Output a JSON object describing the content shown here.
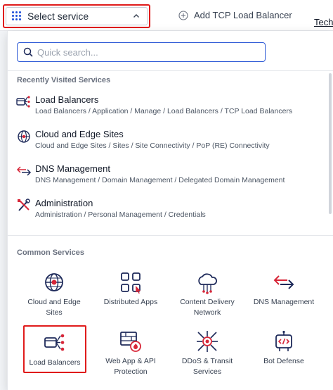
{
  "header": {
    "select_label": "Select service",
    "add_tcp_label": "Add TCP Load Balancer",
    "tech_link": "Tech"
  },
  "search": {
    "placeholder": "Quick search...",
    "value": ""
  },
  "recent": {
    "title": "Recently Visited Services",
    "items": [
      {
        "name": "Load Balancers",
        "path": "Load Balancers / Application / Manage / Load Balancers / TCP Load Balancers",
        "icon": "load-balancer-icon"
      },
      {
        "name": "Cloud and Edge Sites",
        "path": "Cloud and Edge Sites / Sites / Site Connectivity / PoP (RE) Connectivity",
        "icon": "globe-icon"
      },
      {
        "name": "DNS Management",
        "path": "DNS Management / Domain Management / Delegated Domain Management",
        "icon": "dns-arrows-icon"
      },
      {
        "name": "Administration",
        "path": "Administration / Personal Management / Credentials",
        "icon": "tools-icon"
      }
    ]
  },
  "common": {
    "title": "Common Services",
    "tiles": [
      {
        "label_1": "Cloud and Edge",
        "label_2": "Sites",
        "icon": "globe-icon"
      },
      {
        "label_1": "Distributed Apps",
        "label_2": "",
        "icon": "distributed-apps-icon"
      },
      {
        "label_1": "Content Delivery",
        "label_2": "Network",
        "icon": "cloud-cdn-icon"
      },
      {
        "label_1": "DNS Management",
        "label_2": "",
        "icon": "dns-arrows-icon"
      },
      {
        "label_1": "Load Balancers",
        "label_2": "",
        "icon": "load-balancer-icon"
      },
      {
        "label_1": "Web App & API",
        "label_2": "Protection",
        "icon": "firewall-icon"
      },
      {
        "label_1": "DDoS & Transit",
        "label_2": "Services",
        "icon": "ddos-icon"
      },
      {
        "label_1": "Bot Defense",
        "label_2": "",
        "icon": "bot-defense-icon"
      }
    ]
  },
  "colors": {
    "accent": "#2f5bd6",
    "icon_navy": "#1e2a5a",
    "icon_red": "#d72638",
    "highlight": "#e01b1b"
  }
}
